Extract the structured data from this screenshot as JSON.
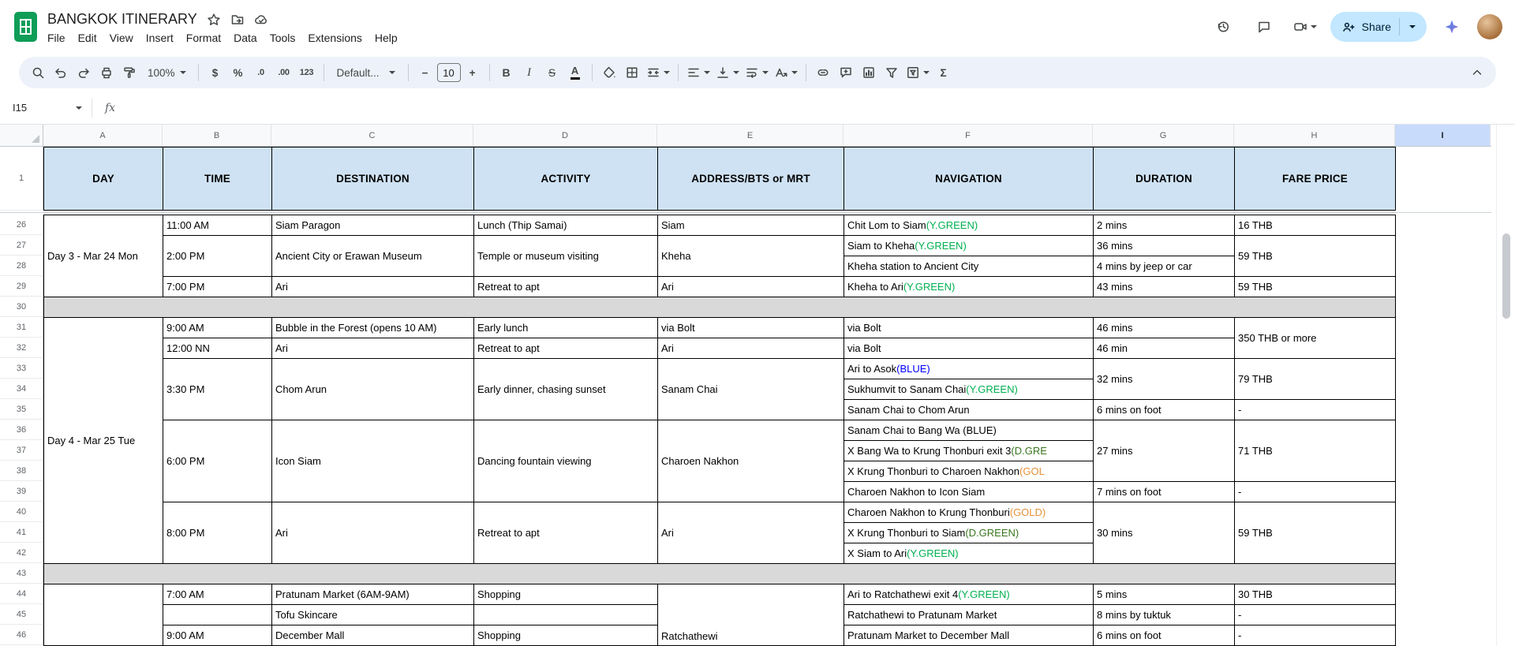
{
  "app": {
    "title": "BANGKOK ITINERARY",
    "menus": [
      "File",
      "Edit",
      "View",
      "Insert",
      "Format",
      "Data",
      "Tools",
      "Extensions",
      "Help"
    ],
    "share_label": "Share"
  },
  "toolbar": {
    "zoom": "100%",
    "currency": "$",
    "percent": "%",
    "decimal_decrease": ".0",
    "decimal_increase": ".00",
    "more_formats": "123",
    "font": "Default...",
    "font_size": "10",
    "decrease_size": "−",
    "increase_size": "+",
    "bold": "B",
    "italic": "I",
    "strikethrough": "S",
    "text_color": "A",
    "functions": "Σ"
  },
  "formula_bar": {
    "name_box": "I15",
    "fx": "fx"
  },
  "icons": {
    "topbar": [
      "star-icon",
      "move-folder-icon",
      "cloud-status-icon",
      "version-history-icon",
      "comments-icon",
      "meet-video-icon",
      "person-add-icon",
      "gemini-sparkle-icon",
      "avatar"
    ],
    "toolbar": [
      "search-icon",
      "undo-icon",
      "redo-icon",
      "print-icon",
      "paint-format-icon",
      "fill-color-icon",
      "borders-icon",
      "merge-cells-icon",
      "horizontal-align-icon",
      "vertical-align-icon",
      "text-wrap-icon",
      "text-rotation-icon",
      "insert-link-icon",
      "insert-comment-icon",
      "insert-chart-icon",
      "create-filter-icon",
      "filter-views-icon",
      "hide-toolbar-icon"
    ]
  },
  "colors": {
    "y_green": "#00b050",
    "d_green": "#38761d",
    "blue": "#0000ff",
    "gold": "#e69138",
    "header_fill": "#cfe2f3",
    "spacer_fill": "#d9d9d9",
    "selected_column_fill": "#c8dbfb",
    "share_fill": "#c2e7ff",
    "logo_green": "#0f9d58"
  },
  "sheet": {
    "columns": [
      "A",
      "B",
      "C",
      "D",
      "E",
      "F",
      "G",
      "H",
      "I"
    ],
    "selected_column": "I",
    "frozen_row_label": "1",
    "data_row_start": 26,
    "data_row_end": 46,
    "spacer_rows": [
      30,
      43
    ],
    "header_labels": {
      "A": "DAY",
      "B": "TIME",
      "C": "DESTINATION",
      "D": "ACTIVITY",
      "E": "ADDRESS/BTS or MRT",
      "F": "NAVIGATION",
      "G": "DURATION",
      "H": "FARE PRICE"
    },
    "cells": [
      {
        "col": "A",
        "r1": 26,
        "r2": 29,
        "t": "Day 3 - Mar 24 Mon"
      },
      {
        "col": "A",
        "r1": 31,
        "r2": 42,
        "t": "Day 4 - Mar 25 Tue"
      },
      {
        "col": "A",
        "r1": 44,
        "r2": 46,
        "t": ""
      },
      {
        "col": "B",
        "r1": 26,
        "r2": 26,
        "t": "11:00 AM"
      },
      {
        "col": "B",
        "r1": 27,
        "r2": 28,
        "t": "2:00 PM"
      },
      {
        "col": "B",
        "r1": 29,
        "r2": 29,
        "t": "7:00 PM"
      },
      {
        "col": "B",
        "r1": 31,
        "r2": 31,
        "t": "9:00 AM"
      },
      {
        "col": "B",
        "r1": 32,
        "r2": 32,
        "t": "12:00 NN"
      },
      {
        "col": "B",
        "r1": 33,
        "r2": 35,
        "t": "3:30 PM"
      },
      {
        "col": "B",
        "r1": 36,
        "r2": 39,
        "t": "6:00 PM"
      },
      {
        "col": "B",
        "r1": 40,
        "r2": 42,
        "t": "8:00 PM"
      },
      {
        "col": "B",
        "r1": 44,
        "r2": 44,
        "t": "7:00 AM"
      },
      {
        "col": "B",
        "r1": 45,
        "r2": 45,
        "t": ""
      },
      {
        "col": "B",
        "r1": 46,
        "r2": 46,
        "t": "9:00 AM"
      },
      {
        "col": "C",
        "r1": 26,
        "r2": 26,
        "t": "Siam Paragon"
      },
      {
        "col": "C",
        "r1": 27,
        "r2": 28,
        "t": "Ancient City or Erawan Museum"
      },
      {
        "col": "C",
        "r1": 29,
        "r2": 29,
        "t": "Ari"
      },
      {
        "col": "C",
        "r1": 31,
        "r2": 31,
        "t": "Bubble in the Forest (opens 10 AM)"
      },
      {
        "col": "C",
        "r1": 32,
        "r2": 32,
        "t": "Ari"
      },
      {
        "col": "C",
        "r1": 33,
        "r2": 35,
        "t": "Chom Arun"
      },
      {
        "col": "C",
        "r1": 36,
        "r2": 39,
        "t": "Icon Siam"
      },
      {
        "col": "C",
        "r1": 40,
        "r2": 42,
        "t": "Ari"
      },
      {
        "col": "C",
        "r1": 44,
        "r2": 44,
        "t": "Pratunam Market (6AM-9AM)"
      },
      {
        "col": "C",
        "r1": 45,
        "r2": 45,
        "t": "Tofu Skincare"
      },
      {
        "col": "C",
        "r1": 46,
        "r2": 46,
        "t": "December Mall"
      },
      {
        "col": "D",
        "r1": 26,
        "r2": 26,
        "t": "Lunch (Thip Samai)"
      },
      {
        "col": "D",
        "r1": 27,
        "r2": 28,
        "t": "Temple or museum visiting"
      },
      {
        "col": "D",
        "r1": 29,
        "r2": 29,
        "t": "Retreat to apt"
      },
      {
        "col": "D",
        "r1": 31,
        "r2": 31,
        "t": "Early lunch"
      },
      {
        "col": "D",
        "r1": 32,
        "r2": 32,
        "t": "Retreat to apt"
      },
      {
        "col": "D",
        "r1": 33,
        "r2": 35,
        "t": "Early dinner, chasing sunset"
      },
      {
        "col": "D",
        "r1": 36,
        "r2": 39,
        "t": "Dancing fountain viewing"
      },
      {
        "col": "D",
        "r1": 40,
        "r2": 42,
        "t": "Retreat to apt"
      },
      {
        "col": "D",
        "r1": 44,
        "r2": 44,
        "t": "Shopping"
      },
      {
        "col": "D",
        "r1": 45,
        "r2": 45,
        "t": ""
      },
      {
        "col": "D",
        "r1": 46,
        "r2": 46,
        "t": "Shopping"
      },
      {
        "col": "E",
        "r1": 26,
        "r2": 26,
        "t": "Siam"
      },
      {
        "col": "E",
        "r1": 27,
        "r2": 28,
        "t": "Kheha"
      },
      {
        "col": "E",
        "r1": 29,
        "r2": 29,
        "t": "Ari"
      },
      {
        "col": "E",
        "r1": 31,
        "r2": 31,
        "t": "via Bolt"
      },
      {
        "col": "E",
        "r1": 32,
        "r2": 32,
        "t": "Ari"
      },
      {
        "col": "E",
        "r1": 33,
        "r2": 35,
        "t": "Sanam Chai"
      },
      {
        "col": "E",
        "r1": 36,
        "r2": 39,
        "t": "Charoen Nakhon"
      },
      {
        "col": "E",
        "r1": 40,
        "r2": 42,
        "t": "Ari"
      },
      {
        "col": "E",
        "r1": 44,
        "r2": 46,
        "t": "Ratchathewi",
        "vb": true
      },
      {
        "col": "F",
        "r1": 26,
        "r2": 26,
        "seg": [
          [
            "Chit Lom to Siam "
          ],
          [
            "(Y.GREEN)",
            "y_green"
          ]
        ]
      },
      {
        "col": "F",
        "r1": 27,
        "r2": 27,
        "seg": [
          [
            "Siam to Kheha "
          ],
          [
            "(Y.GREEN)",
            "y_green"
          ]
        ]
      },
      {
        "col": "F",
        "r1": 28,
        "r2": 28,
        "t": "Kheha station to Ancient City"
      },
      {
        "col": "F",
        "r1": 29,
        "r2": 29,
        "seg": [
          [
            "Kheha to Ari "
          ],
          [
            "(Y.GREEN)",
            "y_green"
          ]
        ]
      },
      {
        "col": "F",
        "r1": 31,
        "r2": 31,
        "t": "via Bolt"
      },
      {
        "col": "F",
        "r1": 32,
        "r2": 32,
        "t": "via Bolt"
      },
      {
        "col": "F",
        "r1": 33,
        "r2": 33,
        "seg": [
          [
            "Ari to Asok "
          ],
          [
            "(BLUE)",
            "blue"
          ]
        ]
      },
      {
        "col": "F",
        "r1": 34,
        "r2": 34,
        "seg": [
          [
            "Sukhumvit to Sanam Chai "
          ],
          [
            "(Y.GREEN)",
            "y_green"
          ]
        ]
      },
      {
        "col": "F",
        "r1": 35,
        "r2": 35,
        "t": "Sanam Chai to Chom Arun"
      },
      {
        "col": "F",
        "r1": 36,
        "r2": 36,
        "t": "Sanam Chai to Bang Wa (BLUE)"
      },
      {
        "col": "F",
        "r1": 37,
        "r2": 37,
        "seg": [
          [
            "X Bang Wa to Krung Thonburi exit 3 "
          ],
          [
            "(D.GRE",
            "d_green"
          ]
        ]
      },
      {
        "col": "F",
        "r1": 38,
        "r2": 38,
        "seg": [
          [
            "X Krung Thonburi to Charoen Nakhon "
          ],
          [
            "(GOL",
            "gold"
          ]
        ]
      },
      {
        "col": "F",
        "r1": 39,
        "r2": 39,
        "t": "Charoen Nakhon to Icon Siam"
      },
      {
        "col": "F",
        "r1": 40,
        "r2": 40,
        "seg": [
          [
            "Charoen Nakhon to Krung Thonburi "
          ],
          [
            "(GOLD)",
            "gold"
          ]
        ]
      },
      {
        "col": "F",
        "r1": 41,
        "r2": 41,
        "seg": [
          [
            "X Krung Thonburi to Siam "
          ],
          [
            "(D.GREEN)",
            "d_green"
          ]
        ]
      },
      {
        "col": "F",
        "r1": 42,
        "r2": 42,
        "seg": [
          [
            "X Siam to Ari "
          ],
          [
            "(Y.GREEN)",
            "y_green"
          ]
        ]
      },
      {
        "col": "F",
        "r1": 44,
        "r2": 44,
        "seg": [
          [
            "Ari to Ratchathewi exit 4 "
          ],
          [
            "(Y.GREEN)",
            "y_green"
          ]
        ]
      },
      {
        "col": "F",
        "r1": 45,
        "r2": 45,
        "t": "Ratchathewi to Pratunam Market"
      },
      {
        "col": "F",
        "r1": 46,
        "r2": 46,
        "t": "Pratunam Market to December Mall"
      },
      {
        "col": "G",
        "r1": 26,
        "r2": 26,
        "t": "2 mins"
      },
      {
        "col": "G",
        "r1": 27,
        "r2": 27,
        "t": "36 mins"
      },
      {
        "col": "G",
        "r1": 28,
        "r2": 28,
        "t": "4 mins by jeep or car"
      },
      {
        "col": "G",
        "r1": 29,
        "r2": 29,
        "t": "43 mins"
      },
      {
        "col": "G",
        "r1": 31,
        "r2": 31,
        "t": "46 mins"
      },
      {
        "col": "G",
        "r1": 32,
        "r2": 32,
        "t": "46 min"
      },
      {
        "col": "G",
        "r1": 33,
        "r2": 34,
        "t": "32 mins"
      },
      {
        "col": "G",
        "r1": 35,
        "r2": 35,
        "t": "6 mins on foot"
      },
      {
        "col": "G",
        "r1": 36,
        "r2": 38,
        "t": "27 mins"
      },
      {
        "col": "G",
        "r1": 39,
        "r2": 39,
        "t": "7 mins on foot"
      },
      {
        "col": "G",
        "r1": 40,
        "r2": 42,
        "t": "30 mins"
      },
      {
        "col": "G",
        "r1": 44,
        "r2": 44,
        "t": "5 mins"
      },
      {
        "col": "G",
        "r1": 45,
        "r2": 45,
        "t": "8 mins by tuktuk"
      },
      {
        "col": "G",
        "r1": 46,
        "r2": 46,
        "t": "6 mins on foot"
      },
      {
        "col": "H",
        "r1": 26,
        "r2": 26,
        "t": "16 THB"
      },
      {
        "col": "H",
        "r1": 27,
        "r2": 28,
        "t": "59 THB"
      },
      {
        "col": "H",
        "r1": 29,
        "r2": 29,
        "t": "59 THB"
      },
      {
        "col": "H",
        "r1": 31,
        "r2": 32,
        "t": "350 THB or more"
      },
      {
        "col": "H",
        "r1": 33,
        "r2": 34,
        "t": "79 THB"
      },
      {
        "col": "H",
        "r1": 35,
        "r2": 35,
        "t": "-"
      },
      {
        "col": "H",
        "r1": 36,
        "r2": 38,
        "t": "71 THB"
      },
      {
        "col": "H",
        "r1": 39,
        "r2": 39,
        "t": "-"
      },
      {
        "col": "H",
        "r1": 40,
        "r2": 42,
        "t": "59 THB"
      },
      {
        "col": "H",
        "r1": 44,
        "r2": 44,
        "t": "30 THB"
      },
      {
        "col": "H",
        "r1": 45,
        "r2": 45,
        "t": "-"
      },
      {
        "col": "H",
        "r1": 46,
        "r2": 46,
        "t": "-"
      }
    ]
  }
}
